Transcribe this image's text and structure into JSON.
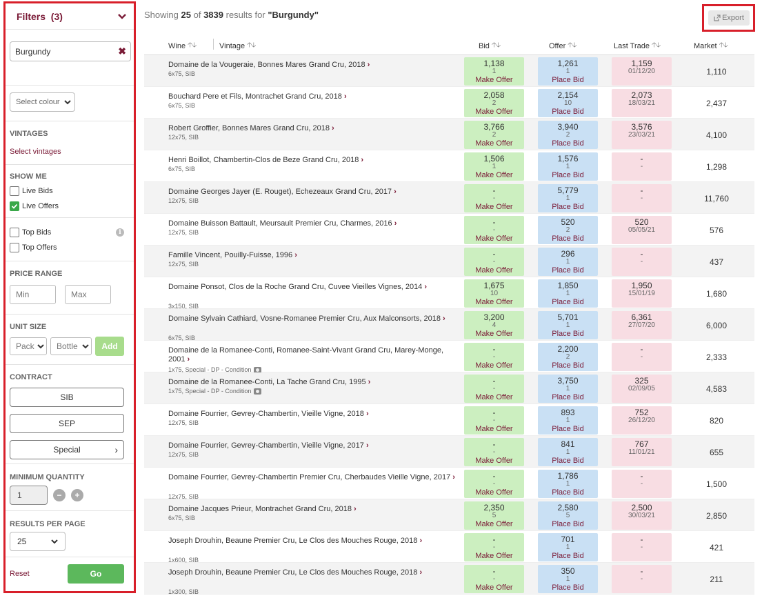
{
  "sidebar": {
    "header": {
      "label": "Filters",
      "count": "(3)"
    },
    "search": {
      "value": "Burgundy"
    },
    "colour_select": "Select colour",
    "vintages": {
      "label": "VINTAGES",
      "link": "Select vintages"
    },
    "show_me": {
      "label": "SHOW ME",
      "live_bids": "Live Bids",
      "live_offers": "Live Offers"
    },
    "top": {
      "top_bids": "Top Bids",
      "top_offers": "Top Offers"
    },
    "price_range": {
      "label": "PRICE RANGE",
      "min_placeholder": "Min",
      "max_placeholder": "Max"
    },
    "unit_size": {
      "label": "UNIT SIZE",
      "pack": "Pack",
      "bottle": "Bottle",
      "add": "Add"
    },
    "contract": {
      "label": "CONTRACT",
      "sib": "SIB",
      "sep": "SEP",
      "special": "Special"
    },
    "min_qty": {
      "label": "MINIMUM QUANTITY",
      "value": "1",
      "minus": "−",
      "plus": "+"
    },
    "results_per_page": {
      "label": "RESULTS PER PAGE",
      "value": "25"
    },
    "reset": "Reset",
    "go": "Go"
  },
  "summary": {
    "prefix": "Showing",
    "count": "25",
    "of": "of",
    "total": "3839",
    "suffix": "results for",
    "query": "\"Burgundy\""
  },
  "export": "Export",
  "columns": {
    "wine": "Wine",
    "vintage": "Vintage",
    "bid": "Bid",
    "offer": "Offer",
    "last": "Last Trade",
    "market": "Market"
  },
  "rows": [
    {
      "name": "Domaine de la Vougeraie, Bonnes Mares Grand Cru, 2018",
      "sub": "6x75, SIB",
      "bid": [
        "1,138",
        "1",
        "Make Offer"
      ],
      "offer": [
        "1,261",
        "1",
        "Place Bid"
      ],
      "last": [
        "1,159",
        "01/12/20"
      ],
      "market": "1,110"
    },
    {
      "name": "Bouchard Pere et Fils, Montrachet Grand Cru, 2018",
      "sub": "6x75, SIB",
      "bid": [
        "2,058",
        "2",
        "Make Offer"
      ],
      "offer": [
        "2,154",
        "10",
        "Place Bid"
      ],
      "last": [
        "2,073",
        "18/03/21"
      ],
      "market": "2,437"
    },
    {
      "name": "Robert Groffier, Bonnes Mares Grand Cru, 2018",
      "sub": "12x75, SIB",
      "bid": [
        "3,766",
        "2",
        "Make Offer"
      ],
      "offer": [
        "3,940",
        "2",
        "Place Bid"
      ],
      "last": [
        "3,576",
        "23/03/21"
      ],
      "market": "4,100"
    },
    {
      "name": "Henri Boillot, Chambertin-Clos de Beze Grand Cru, 2018",
      "sub": "6x75, SIB",
      "bid": [
        "1,506",
        "1",
        "Make Offer"
      ],
      "offer": [
        "1,576",
        "1",
        "Place Bid"
      ],
      "last": [
        "-",
        "-"
      ],
      "market": "1,298"
    },
    {
      "name": "Domaine Georges Jayer (E. Rouget), Echezeaux Grand Cru, 2017",
      "sub": "12x75, SIB",
      "bid": [
        "-",
        "-",
        "Make Offer"
      ],
      "offer": [
        "5,779",
        "1",
        "Place Bid"
      ],
      "last": [
        "-",
        "-"
      ],
      "market": "11,760"
    },
    {
      "name": "Domaine Buisson Battault, Meursault Premier Cru, Charmes, 2016",
      "sub": "12x75, SIB",
      "bid": [
        "-",
        "-",
        "Make Offer"
      ],
      "offer": [
        "520",
        "2",
        "Place Bid"
      ],
      "last": [
        "520",
        "05/05/21"
      ],
      "market": "576"
    },
    {
      "name": "Famille Vincent, Pouilly-Fuisse, 1996",
      "sub": "12x75, SIB",
      "bid": [
        "-",
        "-",
        "Make Offer"
      ],
      "offer": [
        "296",
        "1",
        "Place Bid"
      ],
      "last": [
        "-",
        "-"
      ],
      "market": "437"
    },
    {
      "name": "Domaine Ponsot, Clos de la Roche Grand Cru, Cuvee Vieilles Vignes, 2014",
      "sub": "3x150, SIB",
      "bid": [
        "1,675",
        "10",
        "Make Offer"
      ],
      "offer": [
        "1,850",
        "1",
        "Place Bid"
      ],
      "last": [
        "1,950",
        "15/01/19"
      ],
      "market": "1,680"
    },
    {
      "name": "Domaine Sylvain Cathiard, Vosne-Romanee Premier Cru, Aux Malconsorts, 2018",
      "sub": "6x75, SIB",
      "bid": [
        "3,200",
        "4",
        "Make Offer"
      ],
      "offer": [
        "5,701",
        "1",
        "Place Bid"
      ],
      "last": [
        "6,361",
        "27/07/20"
      ],
      "market": "6,000"
    },
    {
      "name": "Domaine de la Romanee-Conti, Romanee-Saint-Vivant Grand Cru, Marey-Monge, 2001",
      "sub": "1x75,  Special - DP - Condition",
      "cam": true,
      "bid": [
        "-",
        "-",
        "Make Offer"
      ],
      "offer": [
        "2,200",
        "2",
        "Place Bid"
      ],
      "last": [
        "-",
        "-"
      ],
      "market": "2,333"
    },
    {
      "name": "Domaine de la Romanee-Conti, La Tache Grand Cru, 1995",
      "sub": "1x75,  Special - DP - Condition",
      "cam": true,
      "bid": [
        "-",
        "-",
        "Make Offer"
      ],
      "offer": [
        "3,750",
        "1",
        "Place Bid"
      ],
      "last": [
        "325",
        "02/09/05"
      ],
      "market": "4,583"
    },
    {
      "name": "Domaine Fourrier, Gevrey-Chambertin, Vieille Vigne, 2018",
      "sub": "12x75, SIB",
      "bid": [
        "-",
        "-",
        "Make Offer"
      ],
      "offer": [
        "893",
        "1",
        "Place Bid"
      ],
      "last": [
        "752",
        "26/12/20"
      ],
      "market": "820"
    },
    {
      "name": "Domaine Fourrier, Gevrey-Chambertin, Vieille Vigne, 2017",
      "sub": "12x75, SIB",
      "bid": [
        "-",
        "-",
        "Make Offer"
      ],
      "offer": [
        "841",
        "1",
        "Place Bid"
      ],
      "last": [
        "767",
        "11/01/21"
      ],
      "market": "655"
    },
    {
      "name": "Domaine Fourrier, Gevrey-Chambertin Premier Cru, Cherbaudes Vieille Vigne, 2017",
      "sub": "12x75, SIB",
      "bid": [
        "-",
        "-",
        "Make Offer"
      ],
      "offer": [
        "1,786",
        "1",
        "Place Bid"
      ],
      "last": [
        "-",
        "-"
      ],
      "market": "1,500"
    },
    {
      "name": "Domaine Jacques Prieur, Montrachet Grand Cru, 2018",
      "sub": "6x75, SIB",
      "bid": [
        "2,350",
        "5",
        "Make Offer"
      ],
      "offer": [
        "2,580",
        "5",
        "Place Bid"
      ],
      "last": [
        "2,500",
        "30/03/21"
      ],
      "market": "2,850"
    },
    {
      "name": "Joseph Drouhin, Beaune Premier Cru, Le Clos des Mouches Rouge, 2018",
      "sub": "1x600, SIB",
      "bid": [
        "-",
        "-",
        "Make Offer"
      ],
      "offer": [
        "701",
        "1",
        "Place Bid"
      ],
      "last": [
        "-",
        "-"
      ],
      "market": "421"
    },
    {
      "name": "Joseph Drouhin, Beaune Premier Cru, Le Clos des Mouches Rouge, 2018",
      "sub": "1x300, SIB",
      "bid": [
        "-",
        "-",
        "Make Offer"
      ],
      "offer": [
        "350",
        "1",
        "Place Bid"
      ],
      "last": [
        "-",
        "-"
      ],
      "market": "211"
    }
  ]
}
